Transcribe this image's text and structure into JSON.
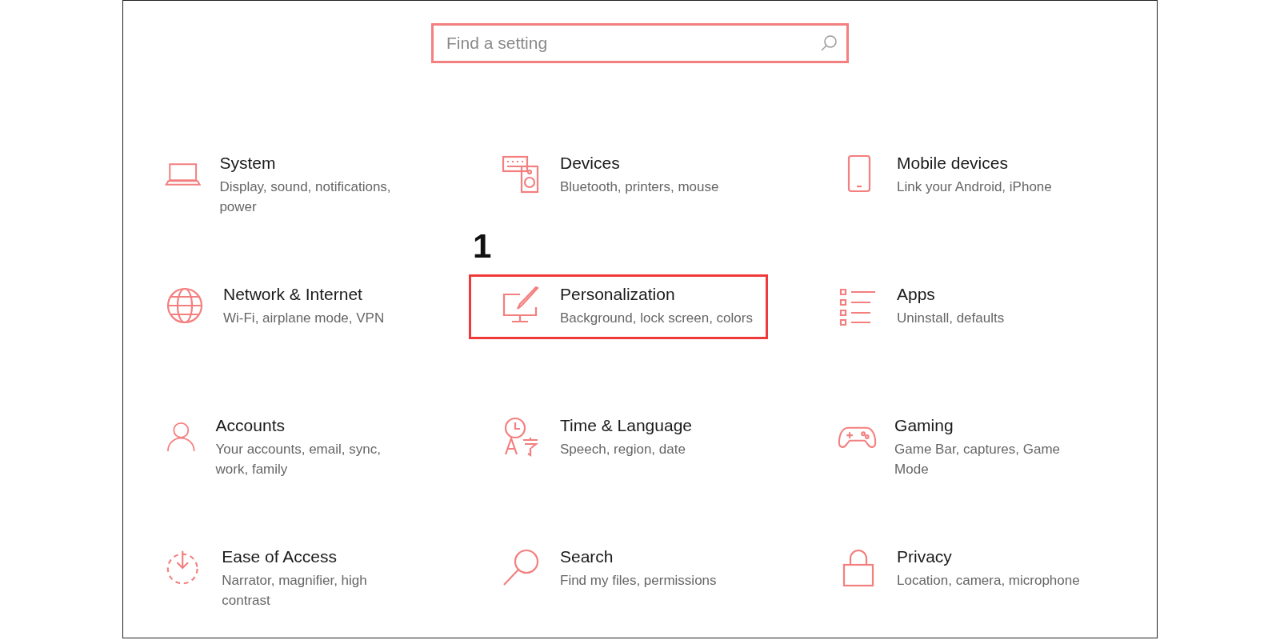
{
  "search": {
    "placeholder": "Find a setting"
  },
  "annotation": "1",
  "categories": [
    {
      "kind": "laptop",
      "title": "System",
      "description": "Display, sound, notifications, power",
      "selected": false
    },
    {
      "kind": "devices",
      "title": "Devices",
      "description": "Bluetooth, printers, mouse",
      "selected": false
    },
    {
      "kind": "phone",
      "title": "Mobile devices",
      "description": "Link your Android, iPhone",
      "selected": false
    },
    {
      "kind": "globe",
      "title": "Network & Internet",
      "description": "Wi-Fi, airplane mode, VPN",
      "selected": false
    },
    {
      "kind": "brush",
      "title": "Personalization",
      "description": "Background, lock screen, colors",
      "selected": true
    },
    {
      "kind": "list",
      "title": "Apps",
      "description": "Uninstall, defaults",
      "selected": false
    },
    {
      "kind": "person",
      "title": "Accounts",
      "description": "Your accounts, email, sync, work, family",
      "selected": false
    },
    {
      "kind": "clock",
      "title": "Time & Language",
      "description": "Speech, region, date",
      "selected": false
    },
    {
      "kind": "gamepad",
      "title": "Gaming",
      "description": "Game Bar, captures, Game Mode",
      "selected": false
    },
    {
      "kind": "ease",
      "title": "Ease of Access",
      "description": "Narrator, magnifier, high contrast",
      "selected": false
    },
    {
      "kind": "search",
      "title": "Search",
      "description": "Find my files, permissions",
      "selected": false
    },
    {
      "kind": "lock",
      "title": "Privacy",
      "description": "Location, camera, microphone",
      "selected": false
    }
  ]
}
